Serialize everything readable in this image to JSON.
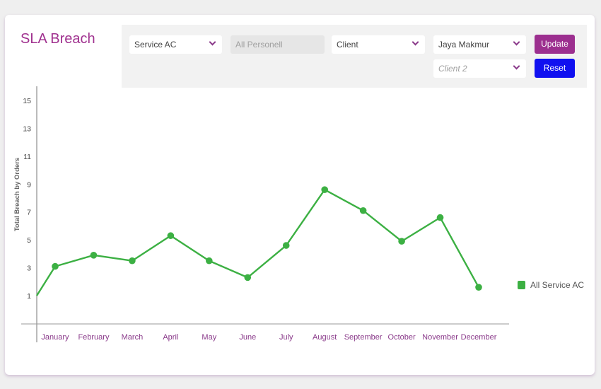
{
  "page": {
    "title": "SLA Breach"
  },
  "filters": {
    "service": {
      "value": "Service AC"
    },
    "personnel": {
      "placeholder": "All Personell"
    },
    "client": {
      "value": "Client"
    },
    "company": {
      "value": "Jaya Makmur"
    },
    "client2": {
      "placeholder": "Client 2"
    },
    "update_label": "Update",
    "reset_label": "Reset"
  },
  "colors": {
    "accent": "#9c2f8f",
    "series": "#3cb043",
    "reset": "#1010f0"
  },
  "chart_data": {
    "type": "line",
    "ylabel": "Total Breach by Orders",
    "xlabel": "",
    "ylim": [
      -1,
      16
    ],
    "yticks": [
      1,
      3,
      5,
      7,
      9,
      11,
      13,
      15
    ],
    "categories": [
      "January",
      "February",
      "March",
      "April",
      "May",
      "June",
      "July",
      "August",
      "September",
      "October",
      "November",
      "December"
    ],
    "series": [
      {
        "name": "All Service AC",
        "values": [
          3.1,
          3.9,
          3.5,
          5.3,
          3.5,
          2.3,
          4.6,
          8.6,
          7.1,
          4.9,
          6.6,
          1.6
        ]
      }
    ],
    "line_start_value": 1.0,
    "legend": "right",
    "grid": false
  }
}
